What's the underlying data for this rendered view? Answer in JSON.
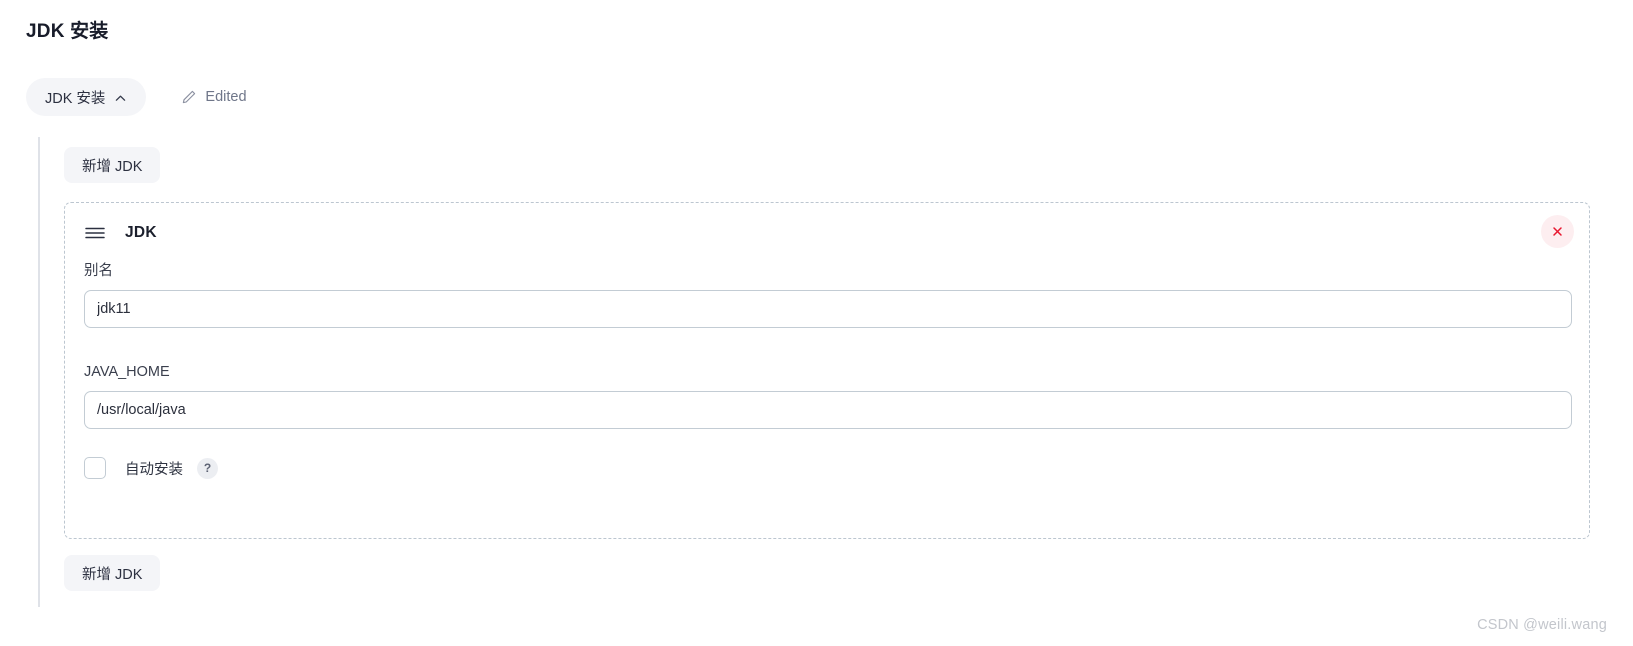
{
  "page": {
    "title": "JDK 安装"
  },
  "section": {
    "pill_label": "JDK 安装",
    "pill_chevron_icon": "chevron-up-icon",
    "edited_icon": "pencil-icon",
    "edited_label": "Edited"
  },
  "actions": {
    "add_top_label": "新增 JDK",
    "add_bottom_label": "新增 JDK"
  },
  "card": {
    "drag_icon": "hamburger-drag-handle-icon",
    "title": "JDK",
    "close_icon": "close-x-icon",
    "fields": [
      {
        "label": "别名",
        "value": "jdk11",
        "placeholder": "别名"
      },
      {
        "label": "JAVA_HOME",
        "value": "/usr/local/java",
        "placeholder": "JAVA_HOME"
      }
    ],
    "checkbox": {
      "label": "自动安装",
      "checked": false,
      "help_label": "?"
    }
  },
  "watermark": {
    "text": "CSDN @weili.wang"
  },
  "colors": {
    "accent_danger": "#e8172f",
    "danger_bg": "#fdeef0",
    "pill_bg": "#f4f5f8",
    "dashed_border": "#bcc6d0",
    "input_border": "#c3ccd4",
    "rail": "#dfe2e8",
    "watermark": "#c3c6cc"
  }
}
